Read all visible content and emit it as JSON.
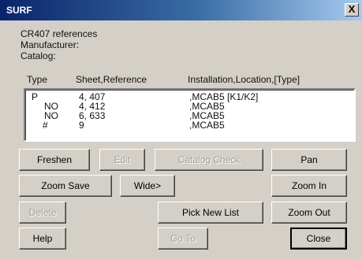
{
  "window": {
    "title": "SURF",
    "close_glyph": "X"
  },
  "info": {
    "references": "CR407 references",
    "manufacturer": "Manufacturer:",
    "catalog": "Catalog:"
  },
  "columns": {
    "type": "Type",
    "sheet_reference": "Sheet,Reference",
    "installation": "Installation,Location,[Type]"
  },
  "rows": [
    {
      "type": "P",
      "sheet": "4, 407",
      "installation": ",MCAB5 [K1/K2]"
    },
    {
      "type": "NO",
      "sheet": "4, 412",
      "installation": ",MCAB5"
    },
    {
      "type": "NO",
      "sheet": "6, 633",
      "installation": ",MCAB5"
    },
    {
      "type": "#",
      "sheet": "9",
      "installation": ",MCAB5"
    }
  ],
  "buttons": {
    "freshen": "Freshen",
    "edit": "Edit",
    "catalog_check": "Catalog Check",
    "pan": "Pan",
    "zoom_save": "Zoom Save",
    "wide": "Wide>",
    "zoom_in": "Zoom In",
    "delete": "Delete",
    "pick_new_list": "Pick New List",
    "zoom_out": "Zoom Out",
    "help": "Help",
    "go_to": "Go To",
    "close": "Close"
  }
}
